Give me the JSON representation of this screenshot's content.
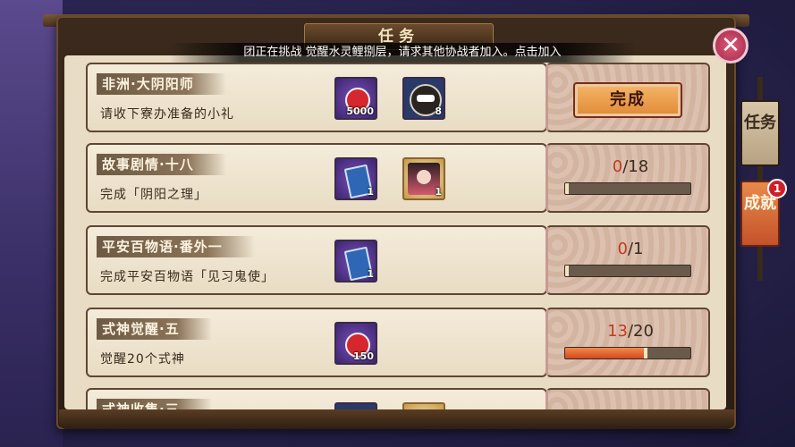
{
  "window": {
    "title": "任务"
  },
  "broadcast": "团正在挑战 觉醒水灵鲤捌层，请求其他协战者加入。点击加入",
  "close_label": "✕",
  "side_tabs": [
    {
      "label": "任务",
      "active": false
    },
    {
      "label": "成就",
      "active": true,
      "badge": "1"
    }
  ],
  "tasks": [
    {
      "title": "非洲·大阴阳师",
      "desc": "请收下寮办准备的小礼",
      "rewards": [
        {
          "icon": "red-magatama-icon",
          "amount": "5000"
        },
        {
          "icon": "daruma-icon",
          "amount": "8"
        }
      ],
      "status": "complete",
      "button_label": "完成"
    },
    {
      "title": "故事剧情·十八",
      "desc": "完成「阴阳之理」",
      "rewards": [
        {
          "icon": "blue-scroll-icon",
          "amount": "1"
        },
        {
          "icon": "shikigami-portrait-icon",
          "amount": "1"
        }
      ],
      "status": "progress",
      "current": "0",
      "total": "/18",
      "progress": 0
    },
    {
      "title": "平安百物语·番外一",
      "desc": "完成平安百物语「见习鬼使」",
      "rewards": [
        {
          "icon": "blue-scroll-icon",
          "amount": "1"
        }
      ],
      "status": "progress",
      "current": "0",
      "total": "/1",
      "progress": 0
    },
    {
      "title": "式神觉醒·五",
      "desc": "觉醒20个式神",
      "rewards": [
        {
          "icon": "red-magatama-icon",
          "amount": "150"
        }
      ],
      "status": "progress",
      "current": "13",
      "total": "/20",
      "progress": 0.65
    },
    {
      "title": "式神收集·三",
      "desc": "",
      "rewards": [],
      "status": "progress",
      "current": "",
      "total": "",
      "progress": 0
    }
  ]
}
